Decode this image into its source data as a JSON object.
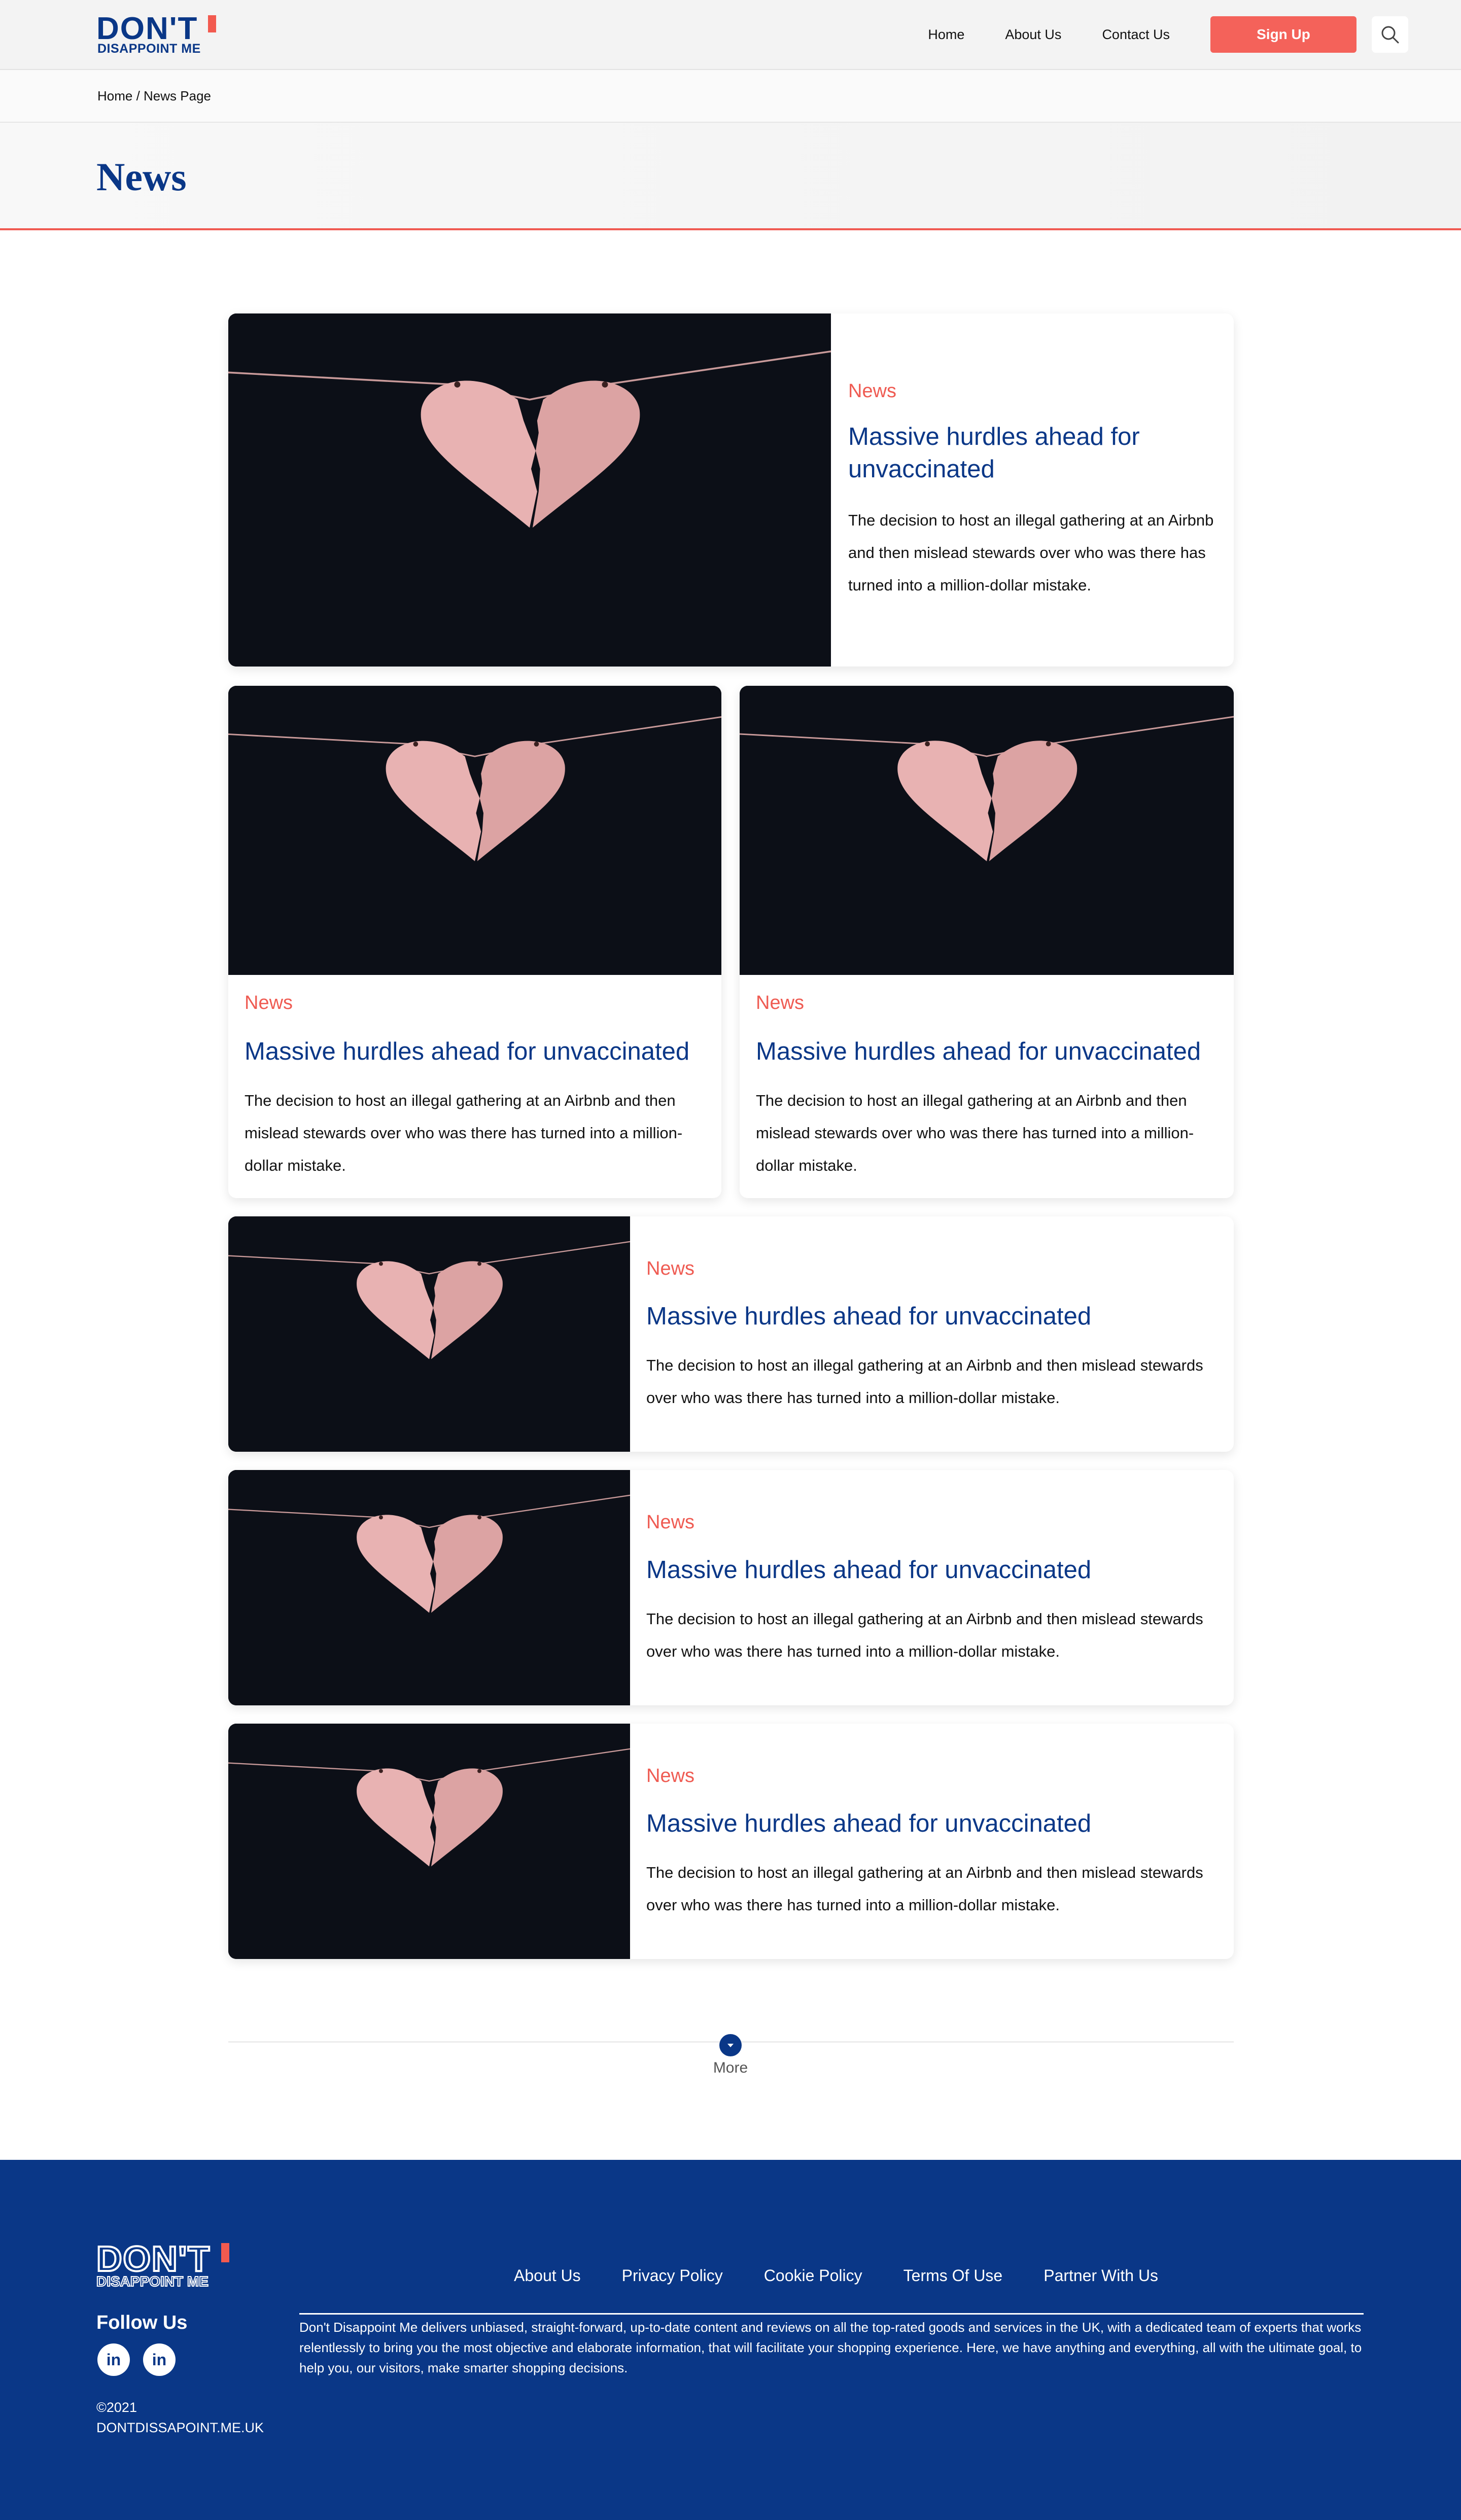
{
  "header": {
    "logo_line1": "DON'T",
    "logo_line2": "DISAPPOINT ME",
    "nav": [
      "Home",
      "About Us",
      "Contact Us"
    ],
    "signup_label": "Sign Up"
  },
  "breadcrumb": "Home / News Page",
  "page_title": "News",
  "articles": [
    {
      "category": "News",
      "title": "Massive hurdles ahead for unvaccinated",
      "description": "The decision to host an illegal gathering at an Airbnb and then mislead stewards over who was there has turned into a million-dollar mistake."
    },
    {
      "category": "News",
      "title": "Massive hurdles ahead for unvaccinated",
      "description": "The decision to host an illegal gathering at an Airbnb and then mislead stewards over who was there has turned into a million-dollar mistake."
    },
    {
      "category": "News",
      "title": "Massive hurdles ahead for unvaccinated",
      "description": "The decision to host an illegal gathering at an Airbnb and then mislead stewards over who was there has turned into a million-dollar mistake."
    },
    {
      "category": "News",
      "title": "Massive hurdles ahead for unvaccinated",
      "description": "The decision to host an illegal gathering at an Airbnb and then mislead stewards over who was there has turned into a million-dollar mistake."
    },
    {
      "category": "News",
      "title": "Massive hurdles ahead for unvaccinated",
      "description": "The decision to host an illegal gathering at an Airbnb and then mislead stewards over who was there has turned into a million-dollar mistake."
    },
    {
      "category": "News",
      "title": "Massive hurdles ahead for unvaccinated",
      "description": "The decision to host an illegal gathering at an Airbnb and then mislead stewards over who was there has turned into a million-dollar mistake."
    }
  ],
  "more_label": "More",
  "footer": {
    "logo_line1": "DON'T",
    "logo_line2": "DISAPPOINT ME",
    "follow_label": "Follow Us",
    "social": [
      "in",
      "in"
    ],
    "copyright": "©2021",
    "domain": "DONTDISSAPOINT.ME.UK",
    "links": [
      "About Us",
      "Privacy Policy",
      "Cookie Policy",
      "Terms Of Use",
      "Partner With Us"
    ],
    "about": "Don't Disappoint Me delivers unbiased, straight-forward, up-to-date content and reviews on all the top-rated goods and services in the UK, with a dedicated team of experts that works relentlessly to bring you the most objective and elaborate information, that will facilitate your shopping experience. Here, we have anything and everything, all with the ultimate goal, to help you, our visitors, make smarter shopping decisions."
  },
  "colors": {
    "brand_blue": "#0a3787",
    "accent_coral": "#f4625a"
  }
}
